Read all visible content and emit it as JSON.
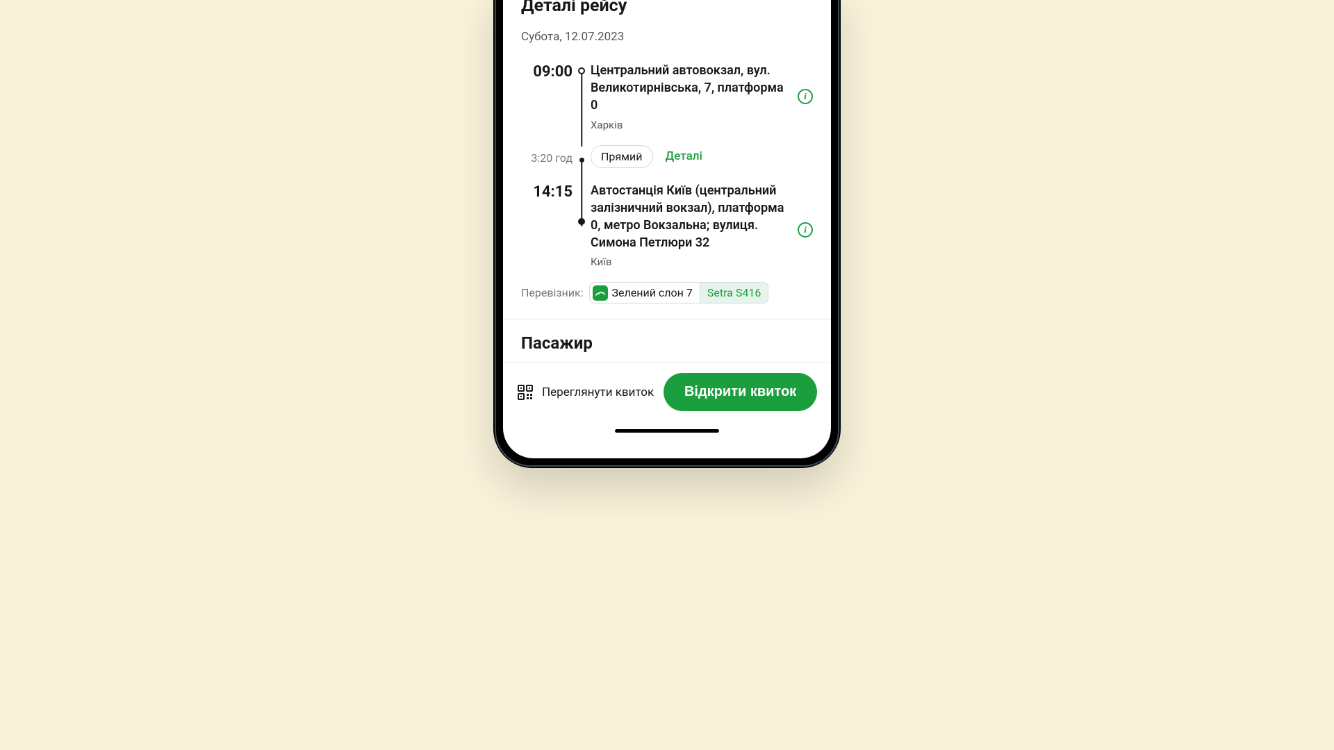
{
  "trip": {
    "title": "Деталі рейсу",
    "date": "Субота, 12.07.2023",
    "departure": {
      "time": "09:00",
      "station": "Центральний автовокзал, вул. Великотирнівська, 7, платформа 0",
      "city": "Харків"
    },
    "duration": "3:20 год",
    "direct_chip": "Прямий",
    "details_link": "Деталі",
    "arrival": {
      "time": "14:15",
      "station": "Автостанція Київ (центральний залізничний вокзал), платформа 0, метро Вокзальна; вулиця. Симона Петлюри 32",
      "city": "Київ"
    },
    "carrier": {
      "label": "Перевізник:",
      "name": "Зелений слон 7",
      "vehicle": "Setra S416"
    }
  },
  "passenger": {
    "title": "Пасажир"
  },
  "footer": {
    "view_ticket": "Переглянути квиток",
    "open_ticket": "Відкрити квиток"
  },
  "info_glyph": "i"
}
